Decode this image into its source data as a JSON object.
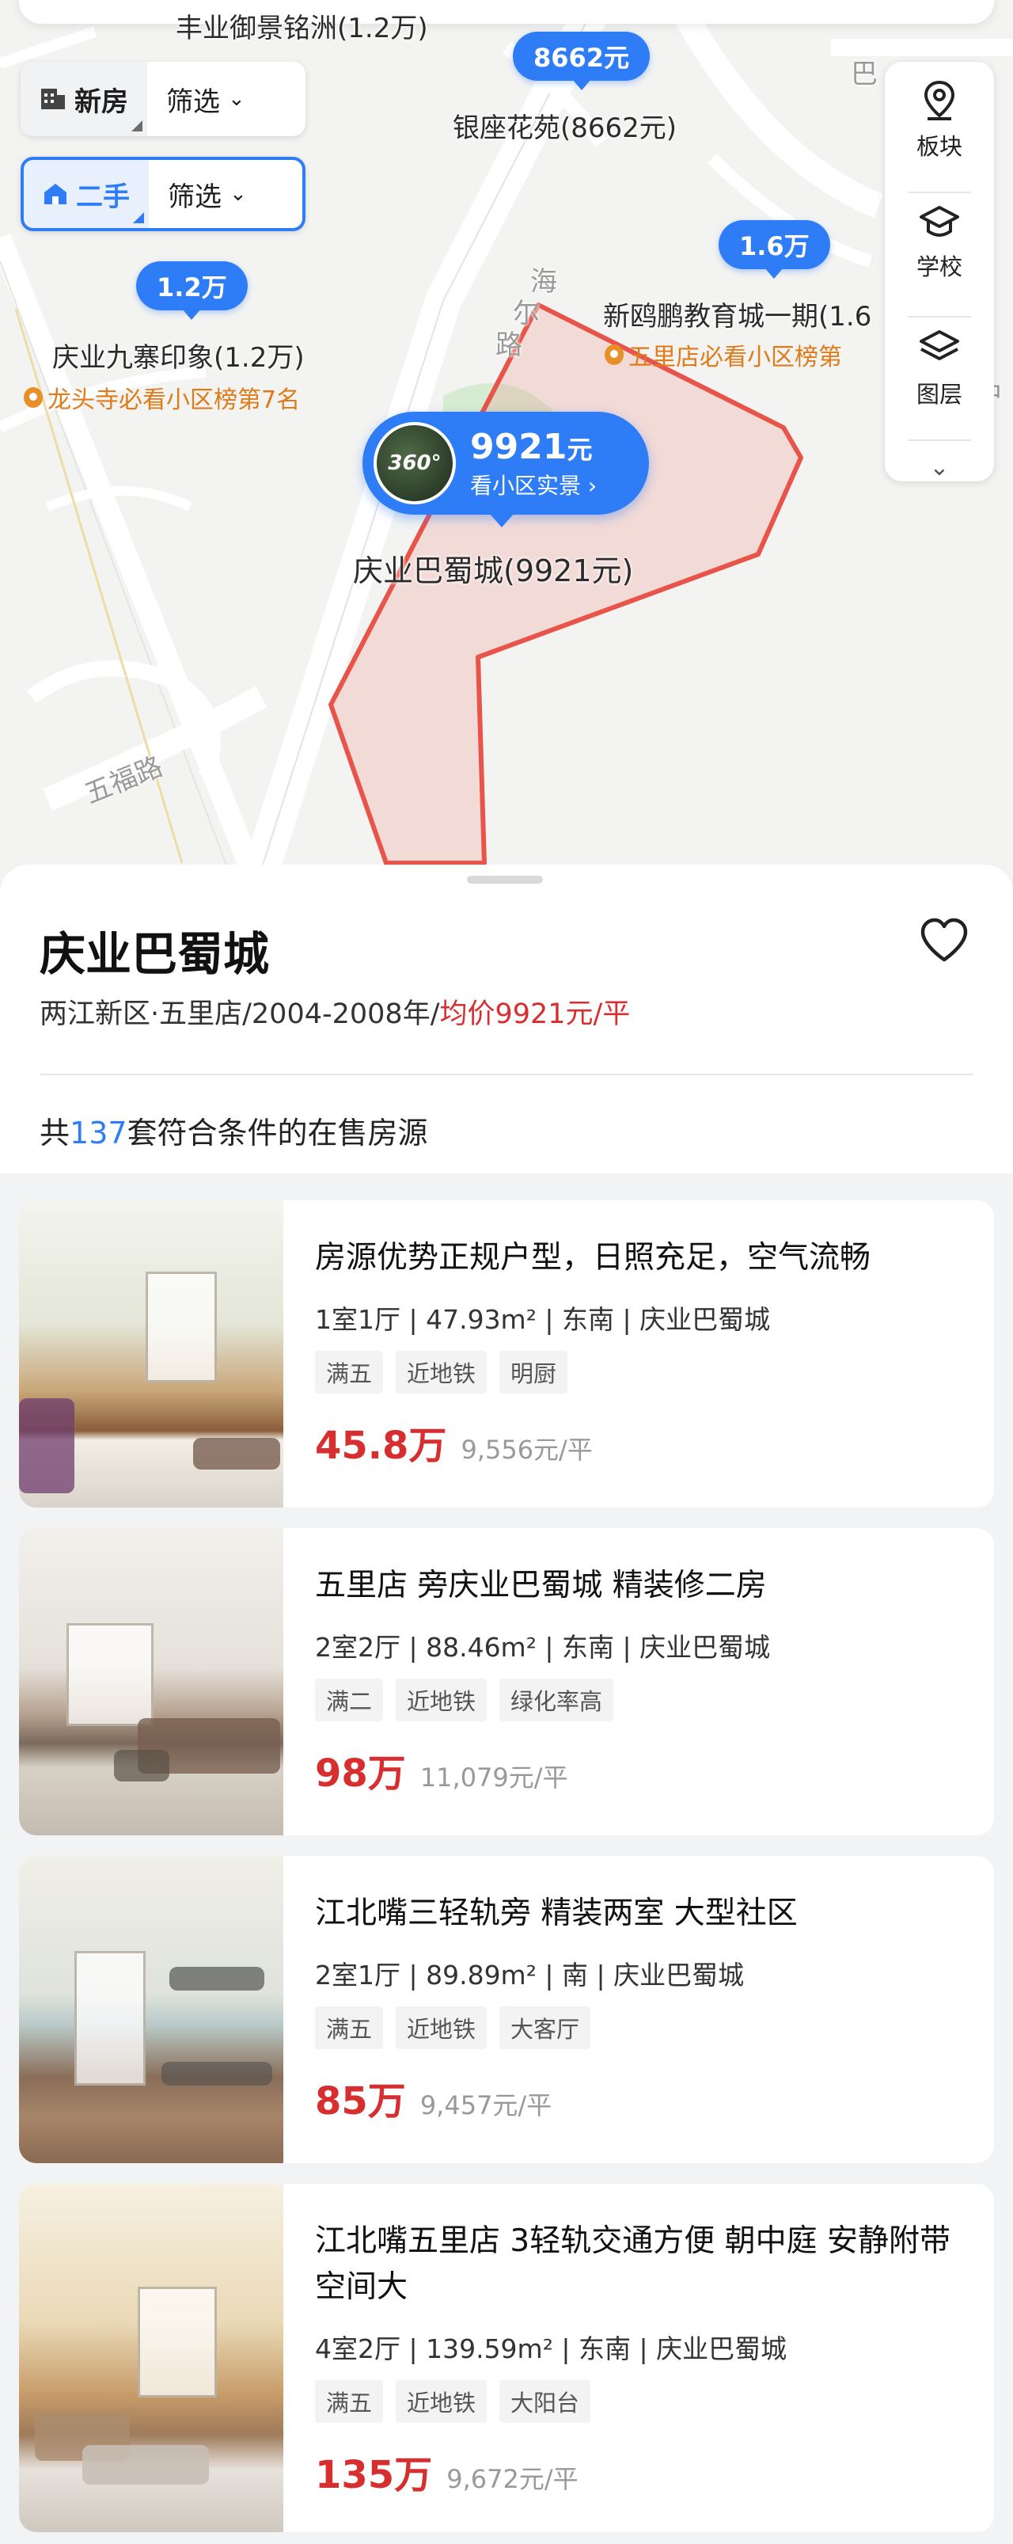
{
  "map": {
    "labels": {
      "top_estate": "丰业御景铭洲(1.2万)",
      "yinzuo": "银座花苑(8662元)",
      "jiuzhai": "庆业九寨印象(1.2万)",
      "xinoupeng": "新鸥鹏教育城一期(1.6",
      "bashu": "庆业巴蜀城(9921元)",
      "road_wufu": "五福路",
      "road_hai": "海",
      "road_er": "尔",
      "road_lu": "路",
      "edge_ba": "巴",
      "edge_zhong": "中"
    },
    "rank_tags": {
      "longtou": "龙头寺必看小区榜第7名",
      "wuli": "五里店必看小区榜第"
    },
    "pins": {
      "p8662": "8662元",
      "p12": "1.2万",
      "p16": "1.6万"
    },
    "highlight_pin": {
      "price_num": "9921",
      "price_unit": "元",
      "sub": "看小区实景",
      "badge": "360°"
    },
    "filters": {
      "new": {
        "label": "新房",
        "filter": "筛选"
      },
      "second": {
        "label": "二手",
        "filter": "筛选"
      }
    },
    "tools": [
      {
        "label": "板块",
        "icon": "location-pin-icon"
      },
      {
        "label": "学校",
        "icon": "graduation-cap-icon"
      },
      {
        "label": "图层",
        "icon": "layers-icon"
      }
    ]
  },
  "community": {
    "name": "庆业巴蜀城",
    "meta_plain": "两江新区·五里店/2004-2008年/",
    "avg_price": "均价9921元/平",
    "count_prefix": "共",
    "count": "137",
    "count_suffix": "套符合条件的在售房源"
  },
  "listings": [
    {
      "title": "房源优势正规户型，日照充足，空气流畅",
      "attrs": "1室1厅 | 47.93m² | 东南 | 庆业巴蜀城",
      "tags": [
        "满五",
        "近地铁",
        "明厨"
      ],
      "total": "45.8万",
      "unit_price": "9,556元/平"
    },
    {
      "title": "五里店 旁庆业巴蜀城 精装修二房",
      "attrs": "2室2厅 | 88.46m² | 东南 | 庆业巴蜀城",
      "tags": [
        "满二",
        "近地铁",
        "绿化率高"
      ],
      "total": "98万",
      "unit_price": "11,079元/平"
    },
    {
      "title": "江北嘴三轻轨旁 精装两室  大型社区",
      "attrs": "2室1厅 | 89.89m² | 南 | 庆业巴蜀城",
      "tags": [
        "满五",
        "近地铁",
        "大客厅"
      ],
      "total": "85万",
      "unit_price": "9,457元/平"
    },
    {
      "title": "江北嘴五里店 3轻轨交通方便 朝中庭 安静附带空间大",
      "attrs": "4室2厅 | 139.59m² | 东南 | 庆业巴蜀城",
      "tags": [
        "满五",
        "近地铁",
        "大阳台"
      ],
      "total": "135万",
      "unit_price": "9,672元/平"
    }
  ],
  "colors": {
    "accent": "#2f7df6",
    "price_red": "#d72f2f",
    "rank_orange": "#e07b1a",
    "boundary": "#e8534a"
  }
}
